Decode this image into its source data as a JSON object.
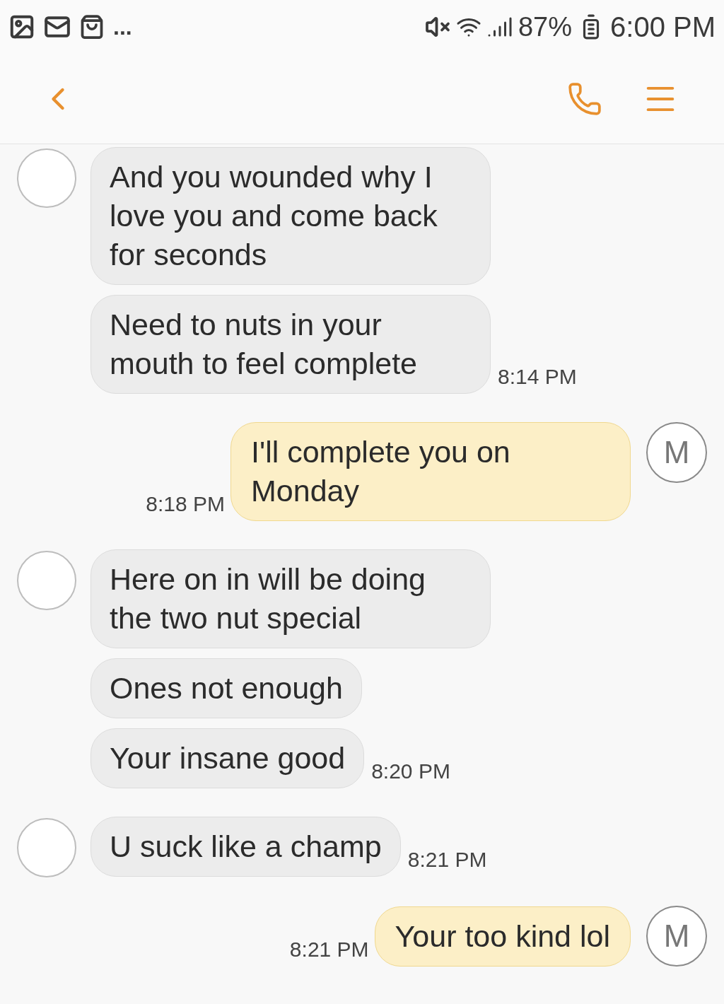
{
  "status_bar": {
    "more": "...",
    "battery": "87%",
    "time": "6:00 PM"
  },
  "messages": [
    {
      "kind": "incoming",
      "bubbles": [
        "And you wounded why I love you and come back for seconds",
        "Need to nuts in your mouth to feel complete"
      ],
      "time": "8:14 PM"
    },
    {
      "kind": "outgoing",
      "bubbles": [
        "I'll complete you on Monday"
      ],
      "time": "8:18 PM",
      "avatar": "M"
    },
    {
      "kind": "incoming",
      "bubbles": [
        "Here on in will be doing the two nut special",
        "Ones not enough",
        "Your insane good"
      ],
      "time": "8:20 PM"
    },
    {
      "kind": "incoming",
      "bubbles": [
        "U suck like a champ"
      ],
      "time": "8:21 PM"
    },
    {
      "kind": "outgoing",
      "bubbles": [
        "Your too kind lol"
      ],
      "time": "8:21 PM",
      "avatar": "M"
    }
  ]
}
